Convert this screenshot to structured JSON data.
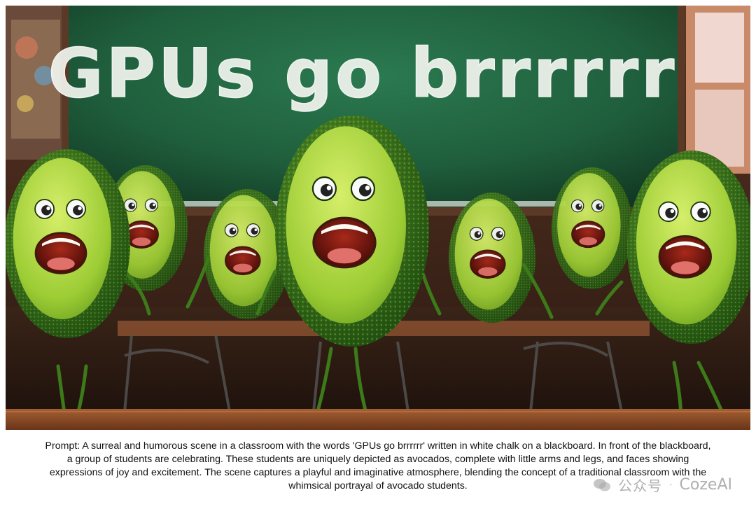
{
  "scene": {
    "blackboard_text": "GPUs go brrrrrr"
  },
  "caption": {
    "text": "Prompt: A surreal and humorous scene in a classroom with the words 'GPUs go brrrrrr' written in white chalk on a blackboard. In front of the blackboard, a group of students are celebrating. These students are uniquely depicted as avocados, complete with little arms and legs, and faces showing expressions of joy and excitement. The scene captures a playful and imaginative atmosphere, blending the concept of a traditional classroom with the whimsical portrayal of avocado students."
  },
  "watermark": {
    "left_text": "公众号",
    "separator": "·",
    "right_text": "CozeAI"
  },
  "colors": {
    "blackboard": "#1f5e3c",
    "chalk": "#f2f5ef",
    "avocado_skin": "#3f7d1e",
    "avocado_flesh": "#b6dc3a",
    "mouth": "#7a1810",
    "desk": "#8a4a26"
  }
}
